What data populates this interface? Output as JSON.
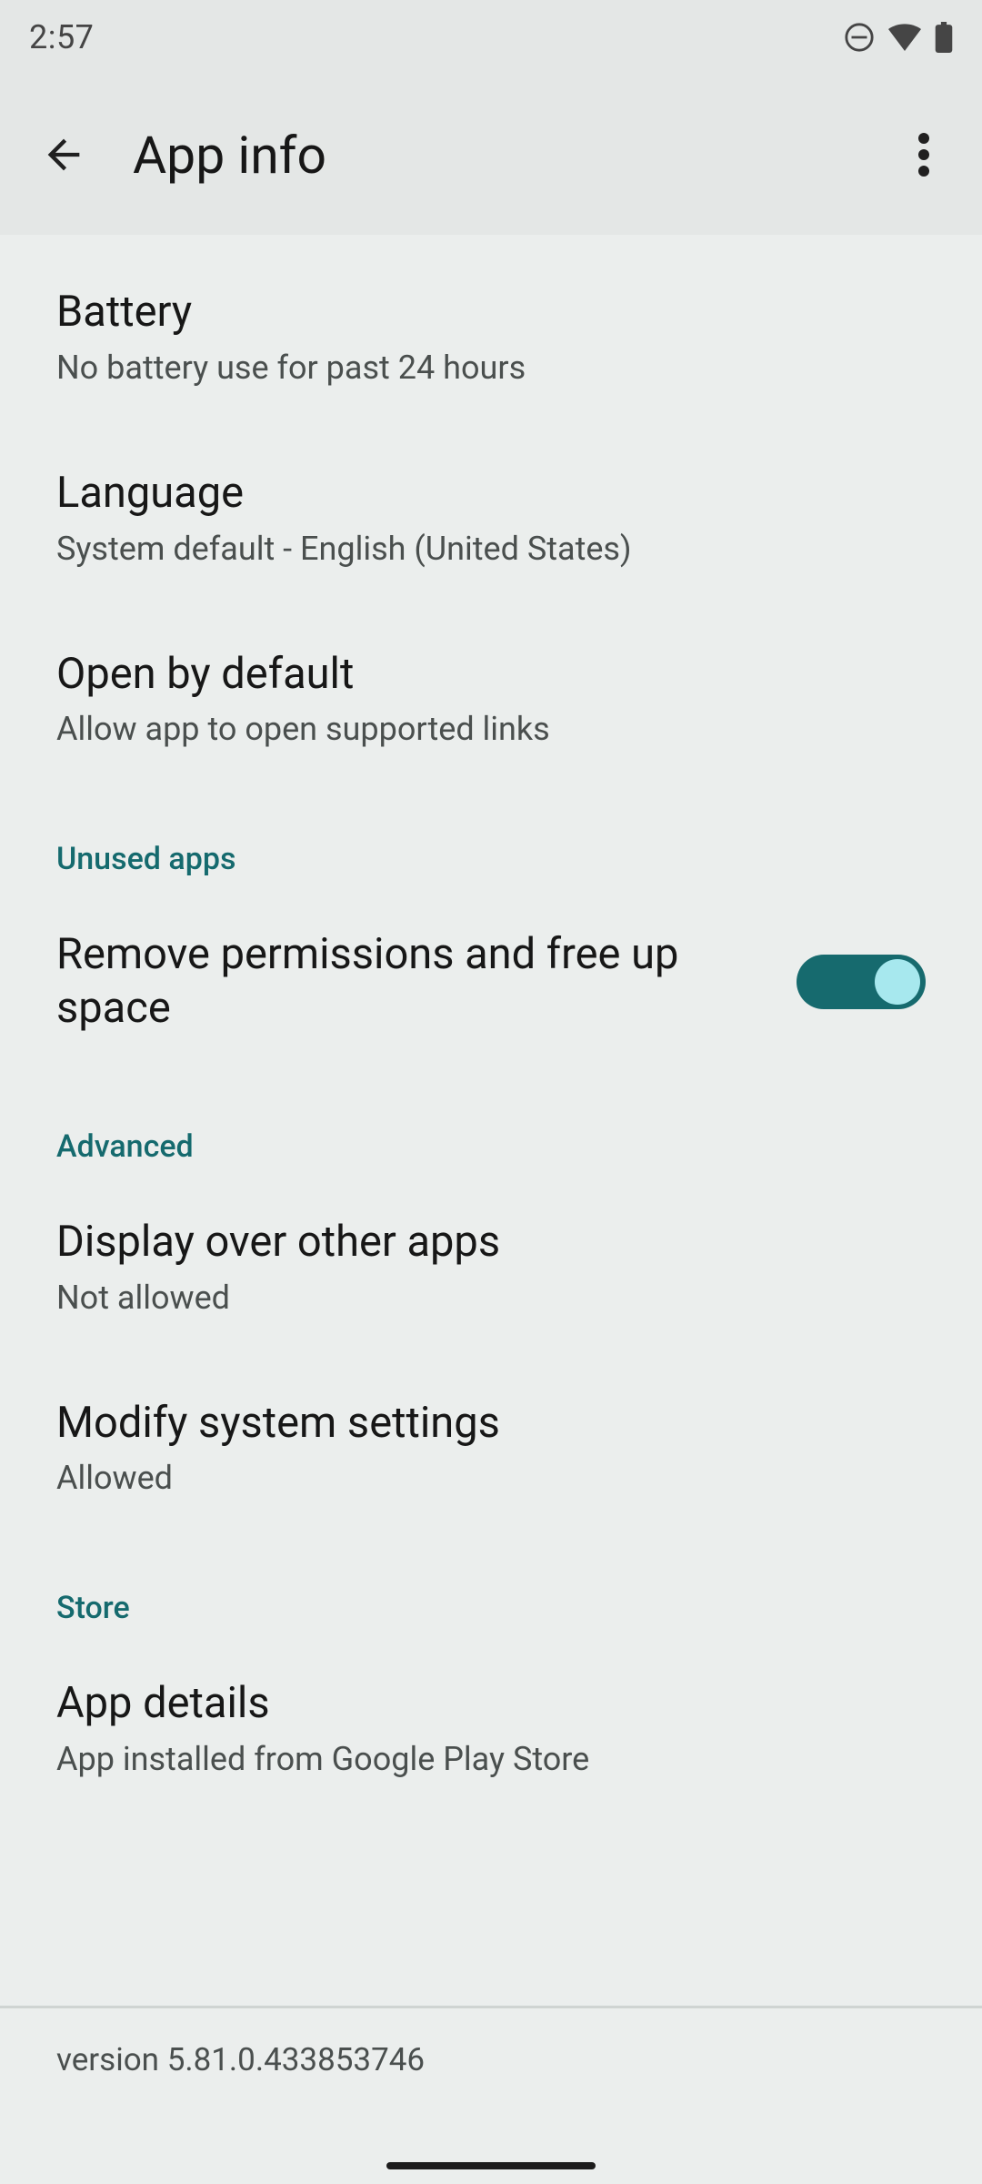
{
  "status_bar": {
    "time": "2:57"
  },
  "app_bar": {
    "title": "App info"
  },
  "main": {
    "battery": {
      "title": "Battery",
      "sub": "No battery use for past 24 hours"
    },
    "language": {
      "title": "Language",
      "sub": "System default - English (United States)"
    },
    "open_default": {
      "title": "Open by default",
      "sub": "Allow app to open supported links"
    },
    "unused_header": "Unused apps",
    "remove_perms": {
      "title": "Remove permissions and free up space"
    },
    "advanced_header": "Advanced",
    "display_over": {
      "title": "Display over other apps",
      "sub": "Not allowed"
    },
    "modify_system": {
      "title": "Modify system settings",
      "sub": "Allowed"
    },
    "store_header": "Store",
    "app_details": {
      "title": "App details",
      "sub": "App installed from Google Play Store"
    }
  },
  "footer": {
    "version": "version 5.81.0.433853746"
  }
}
